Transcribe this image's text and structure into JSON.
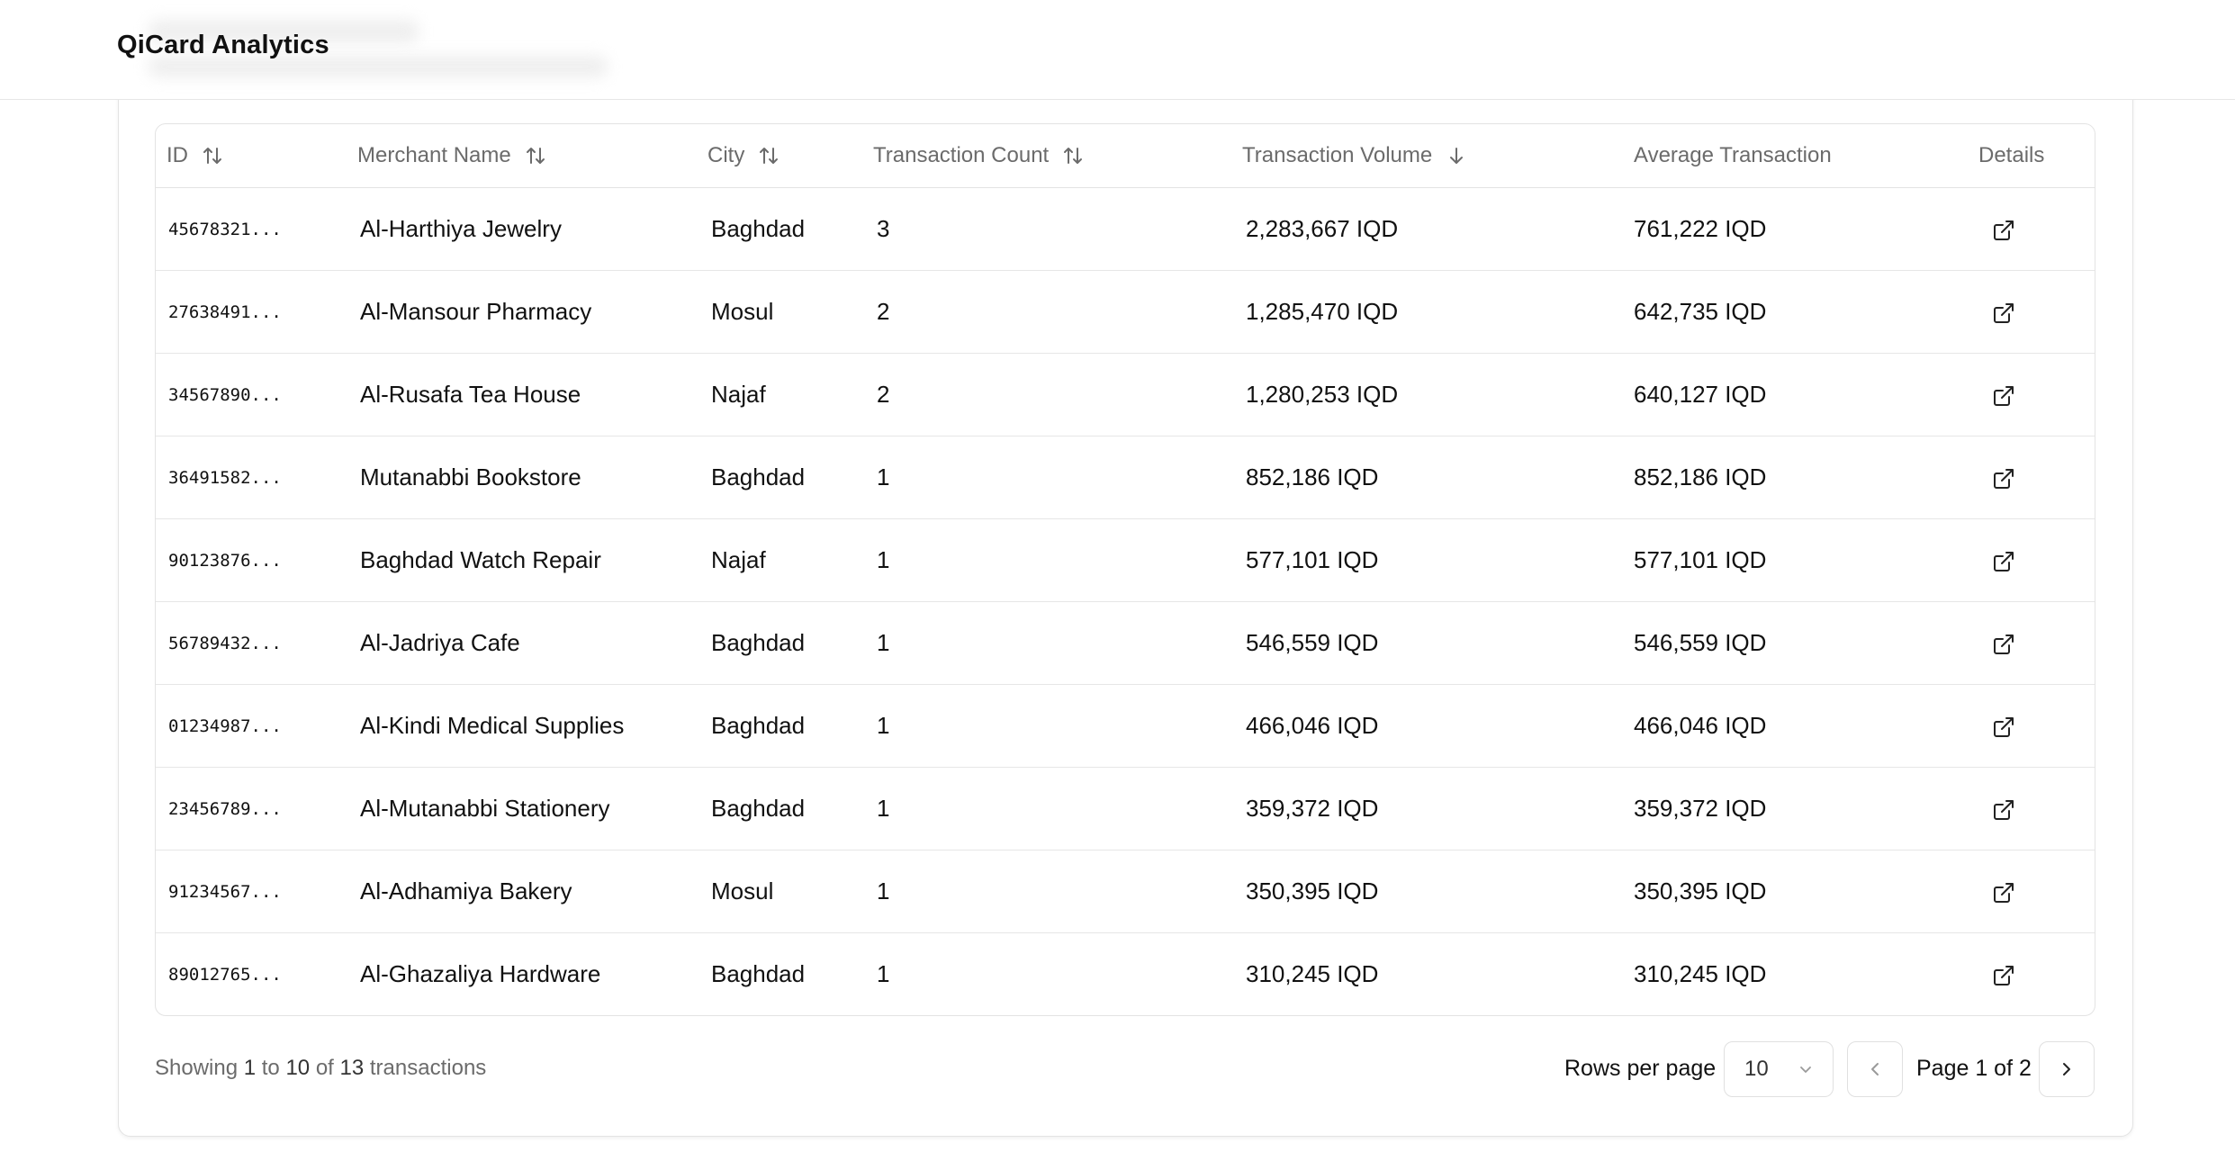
{
  "app": {
    "title": "QiCard Analytics"
  },
  "table": {
    "columns": [
      {
        "label": "ID",
        "sort": "both"
      },
      {
        "label": "Merchant Name",
        "sort": "both"
      },
      {
        "label": "City",
        "sort": "both"
      },
      {
        "label": "Transaction Count",
        "sort": "both"
      },
      {
        "label": "Transaction Volume",
        "sort": "desc"
      },
      {
        "label": "Average Transaction",
        "sort": "none"
      },
      {
        "label": "Details",
        "sort": "none"
      }
    ],
    "rows": [
      {
        "id": "45678321...",
        "merchant": "Al-Harthiya Jewelry",
        "city": "Baghdad",
        "count": "3",
        "volume": "2,283,667 IQD",
        "avg": "761,222 IQD"
      },
      {
        "id": "27638491...",
        "merchant": "Al-Mansour Pharmacy",
        "city": "Mosul",
        "count": "2",
        "volume": "1,285,470 IQD",
        "avg": "642,735 IQD"
      },
      {
        "id": "34567890...",
        "merchant": "Al-Rusafa Tea House",
        "city": "Najaf",
        "count": "2",
        "volume": "1,280,253 IQD",
        "avg": "640,127 IQD"
      },
      {
        "id": "36491582...",
        "merchant": "Mutanabbi Bookstore",
        "city": "Baghdad",
        "count": "1",
        "volume": "852,186 IQD",
        "avg": "852,186 IQD"
      },
      {
        "id": "90123876...",
        "merchant": "Baghdad Watch Repair",
        "city": "Najaf",
        "count": "1",
        "volume": "577,101 IQD",
        "avg": "577,101 IQD"
      },
      {
        "id": "56789432...",
        "merchant": "Al-Jadriya Cafe",
        "city": "Baghdad",
        "count": "1",
        "volume": "546,559 IQD",
        "avg": "546,559 IQD"
      },
      {
        "id": "01234987...",
        "merchant": "Al-Kindi Medical Supplies",
        "city": "Baghdad",
        "count": "1",
        "volume": "466,046 IQD",
        "avg": "466,046 IQD"
      },
      {
        "id": "23456789...",
        "merchant": "Al-Mutanabbi Stationery",
        "city": "Baghdad",
        "count": "1",
        "volume": "359,372 IQD",
        "avg": "359,372 IQD"
      },
      {
        "id": "91234567...",
        "merchant": "Al-Adhamiya Bakery",
        "city": "Mosul",
        "count": "1",
        "volume": "350,395 IQD",
        "avg": "350,395 IQD"
      },
      {
        "id": "89012765...",
        "merchant": "Al-Ghazaliya Hardware",
        "city": "Baghdad",
        "count": "1",
        "volume": "310,245 IQD",
        "avg": "310,245 IQD"
      }
    ],
    "details_icon": "external-link-icon"
  },
  "footer": {
    "showing_prefix": "Showing",
    "from": "1",
    "to_word": "to",
    "to": "10",
    "of_word": "of",
    "total": "13",
    "suffix": "transactions",
    "rows_per_page_label": "Rows per page",
    "rows_per_page_value": "10",
    "page_label": "Page 1 of 2"
  }
}
